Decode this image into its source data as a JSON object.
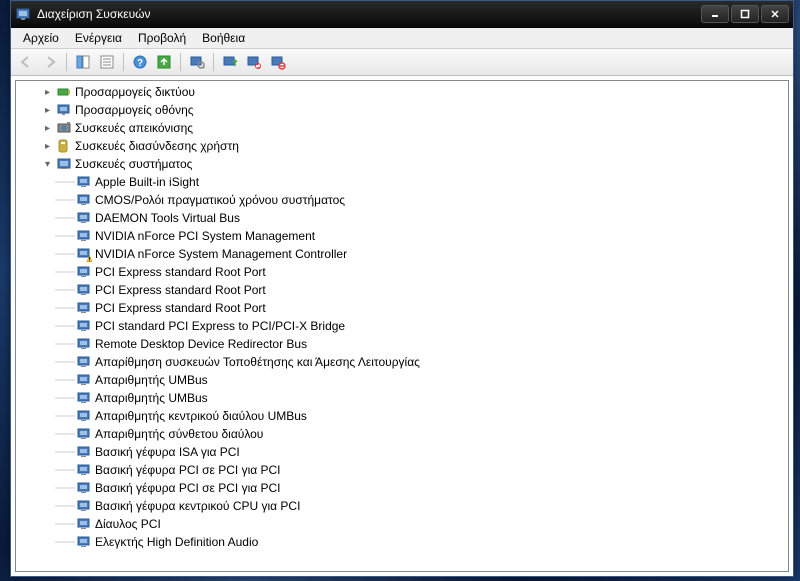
{
  "window": {
    "title": "Διαχείριση Συσκευών"
  },
  "menu": {
    "file": "Αρχείο",
    "action": "Ενέργεια",
    "view": "Προβολή",
    "help": "Βοήθεια"
  },
  "toolbar_icons": {
    "back": "back-arrow",
    "forward": "forward-arrow",
    "show_hide": "show-hide-tree",
    "properties": "properties",
    "help": "help",
    "refresh": "refresh",
    "scan": "scan-hardware",
    "update": "update-driver",
    "uninstall": "uninstall",
    "disable": "disable"
  },
  "tree": {
    "categories": [
      {
        "label": "Προσαρμογείς δικτύου",
        "expanded": false,
        "icon": "network-adapter"
      },
      {
        "label": "Προσαρμογείς οθόνης",
        "expanded": false,
        "icon": "display-adapter"
      },
      {
        "label": "Συσκευές απεικόνισης",
        "expanded": false,
        "icon": "imaging-device"
      },
      {
        "label": "Συσκευές διασύνδεσης χρήστη",
        "expanded": false,
        "icon": "hid-device"
      },
      {
        "label": "Συσκευές συστήματος",
        "expanded": true,
        "icon": "system-device",
        "children": [
          {
            "label": "Apple Built-in iSight",
            "warning": false
          },
          {
            "label": "CMOS/Ρολόι πραγματικού χρόνου συστήματος",
            "warning": false
          },
          {
            "label": "DAEMON Tools Virtual Bus",
            "warning": false
          },
          {
            "label": "NVIDIA nForce PCI System Management",
            "warning": false
          },
          {
            "label": "NVIDIA nForce System Management Controller",
            "warning": true
          },
          {
            "label": "PCI Express standard Root Port",
            "warning": false
          },
          {
            "label": "PCI Express standard Root Port",
            "warning": false
          },
          {
            "label": "PCI Express standard Root Port",
            "warning": false
          },
          {
            "label": "PCI standard PCI Express to PCI/PCI-X Bridge",
            "warning": false
          },
          {
            "label": "Remote Desktop Device Redirector Bus",
            "warning": false
          },
          {
            "label": "Απαρίθμηση συσκευών Τοποθέτησης και Άμεσης Λειτουργίας",
            "warning": false
          },
          {
            "label": "Απαριθμητής UMBus",
            "warning": false
          },
          {
            "label": "Απαριθμητής UMBus",
            "warning": false
          },
          {
            "label": "Απαριθμητής κεντρικού διαύλου UMBus",
            "warning": false
          },
          {
            "label": "Απαριθμητής σύνθετου διαύλου",
            "warning": false
          },
          {
            "label": "Βασική γέφυρα ISA για PCI",
            "warning": false
          },
          {
            "label": "Βασική γέφυρα PCI σε PCI για PCI",
            "warning": false
          },
          {
            "label": "Βασική γέφυρα PCI σε PCI για PCI",
            "warning": false
          },
          {
            "label": "Βασική γέφυρα κεντρικού CPU για PCI",
            "warning": false
          },
          {
            "label": "Δίαυλος PCI",
            "warning": false
          },
          {
            "label": "Ελεγκτής High Definition Audio",
            "warning": false
          }
        ]
      }
    ]
  }
}
